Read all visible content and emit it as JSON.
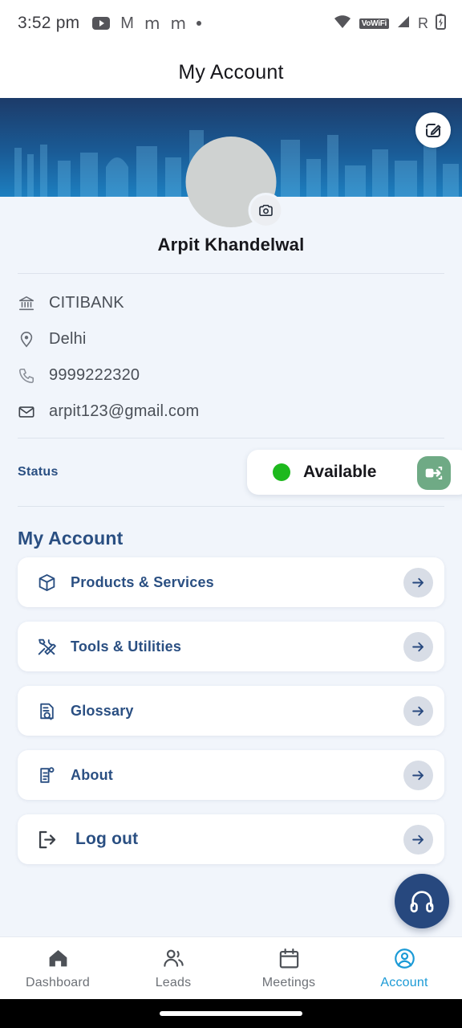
{
  "status_bar": {
    "time": "3:52 pm",
    "left_icons": [
      "youtube-icon",
      "gmail-icon",
      "gmail-alt-icon",
      "gmail-alt2-icon",
      "more-dot-icon"
    ],
    "glyph_m": "m",
    "glyph_gmail": "M",
    "right": {
      "wifi": "wifi-icon",
      "vowifi_label": "VoWiFi",
      "signal": "signal-icon",
      "roaming_label": "R",
      "battery": "battery-charging-icon"
    }
  },
  "header": {
    "title": "My Account",
    "edit_button_name": "edit-profile-button"
  },
  "profile": {
    "name": "Arpit Khandelwal",
    "avatar_name": "profile-avatar",
    "camera_badge_name": "change-photo-button"
  },
  "info": [
    {
      "icon": "bank-icon",
      "text": "CITIBANK"
    },
    {
      "icon": "location-pin-icon",
      "text": "Delhi"
    },
    {
      "icon": "phone-icon",
      "text": "9999222320"
    },
    {
      "icon": "email-icon",
      "text": "arpit123@gmail.com"
    }
  ],
  "status": {
    "label": "Status",
    "value": "Available",
    "dot_color": "#1db91d",
    "switch_button_color": "#6faa85",
    "switch_icon": "status-switch-icon"
  },
  "menu": {
    "section_title": "My Account",
    "items": [
      {
        "label": "Products & Services",
        "icon": "package-box-icon"
      },
      {
        "label": "Tools & Utilities",
        "icon": "tools-icon"
      },
      {
        "label": "Glossary",
        "icon": "document-search-icon"
      },
      {
        "label": "About",
        "icon": "document-info-icon"
      },
      {
        "label": "Log out",
        "icon": "logout-icon"
      }
    ]
  },
  "fab": {
    "name": "support-button",
    "icon": "headphones-icon"
  },
  "bottom_nav": {
    "items": [
      {
        "label": "Dashboard",
        "icon": "home-icon",
        "active": false
      },
      {
        "label": "Leads",
        "icon": "people-icon",
        "active": false
      },
      {
        "label": "Meetings",
        "icon": "calendar-icon",
        "active": false
      },
      {
        "label": "Account",
        "icon": "account-circle-icon",
        "active": true
      }
    ],
    "active_color": "#1b9ad6"
  },
  "colors": {
    "banner_top": "#1c3b69",
    "banner_bottom": "#1d7fc0",
    "page_bg": "#f1f5fb",
    "navy_text": "#2a4f82",
    "fab_bg": "#27487e"
  }
}
